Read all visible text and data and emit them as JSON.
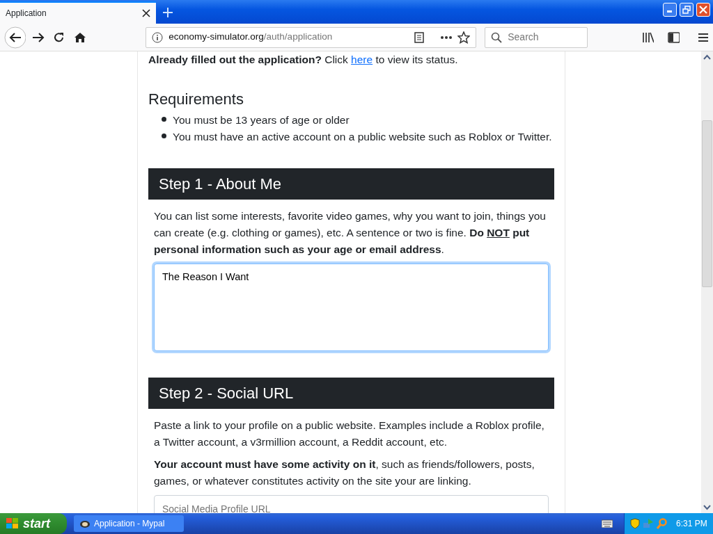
{
  "browser": {
    "tab": {
      "title": "Application",
      "selected": true
    },
    "address": {
      "domain": "economy-simulator.org",
      "path": "/auth/application"
    },
    "search": {
      "placeholder": "Search"
    }
  },
  "status_note": {
    "text": "**Already filled out the application?** Click",
    "link": "here",
    "after": "to view its status."
  },
  "requirements": {
    "title": "Requirements",
    "items": [
      "You must be 13 years of age or older",
      "You must have an active account on a public website such as Roblox or Twitter."
    ]
  },
  "steps": [
    {
      "title": "Step 1 - About Me",
      "paragraphs": [
        [
          {
            "kind": "plain",
            "text": "You can list some interests, favorite video games, why you want to join, things you can create (e.g. clothing or games), etc. A sentence or two is fine. "
          },
          {
            "kind": "bold",
            "text": "Do "
          },
          {
            "kind": "bold-underline",
            "text": "NOT"
          },
          {
            "kind": "bold",
            "text": " put personal information such as your age or email address"
          },
          {
            "kind": "plain",
            "text": "."
          }
        ]
      ],
      "field": {
        "kind": "textarea",
        "value": "The Reason I Want",
        "focused": true
      }
    },
    {
      "title": "Step 2 - Social URL",
      "paragraphs": [
        [
          {
            "kind": "plain",
            "text": "Paste a link to your profile on a public website. Examples include a Roblox profile, a Twitter account, a v3rmillion account, a Reddit account, etc."
          }
        ],
        [
          {
            "kind": "bold",
            "text": "Your account must have some activity on it"
          },
          {
            "kind": "plain",
            "text": ", such as friends/followers, posts, games, or whatever constitutes activity on the site your are linking."
          }
        ]
      ],
      "field": {
        "kind": "input",
        "placeholder": "Social Media Profile URL",
        "focused": false
      }
    }
  ],
  "taskbar": {
    "start": "start",
    "tasks": [
      {
        "label": "Application - Mypal",
        "selected": false
      }
    ],
    "clock": "6:31 PM"
  }
}
